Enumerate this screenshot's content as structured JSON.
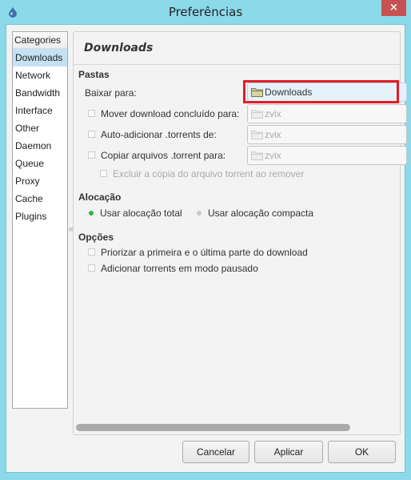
{
  "window": {
    "title": "Preferências",
    "close_label": "×"
  },
  "sidebar": {
    "header": "Categories",
    "items": [
      {
        "label": "Downloads",
        "selected": true
      },
      {
        "label": "Network"
      },
      {
        "label": "Bandwidth"
      },
      {
        "label": "Interface"
      },
      {
        "label": "Other"
      },
      {
        "label": "Daemon"
      },
      {
        "label": "Queue"
      },
      {
        "label": "Proxy"
      },
      {
        "label": "Cache"
      },
      {
        "label": "Plugins"
      }
    ]
  },
  "panel": {
    "title": "Downloads",
    "folders": {
      "heading": "Pastas",
      "download_to_label": "Baixar para:",
      "download_to_value": "Downloads",
      "move_completed_label": "Mover download concluído para:",
      "move_completed_value": "zvix",
      "auto_add_label": "Auto-adicionar .torrents de:",
      "auto_add_value": "zvix",
      "copy_torrent_label": "Copiar arquivos .torrent para:",
      "copy_torrent_value": "zvix",
      "delete_copy_label": "Excluir a cópia do arquivo torrent ao remover"
    },
    "allocation": {
      "heading": "Alocação",
      "full_label": "Usar alocação total",
      "compact_label": "Usar alocação compacta",
      "selected": "full"
    },
    "options": {
      "heading": "Opções",
      "prioritize_label": "Priorizar a primeira e o última parte do download",
      "add_paused_label": "Adicionar torrents em modo pausado"
    }
  },
  "buttons": {
    "cancel": "Cancelar",
    "apply": "Aplicar",
    "ok": "OK"
  },
  "colors": {
    "titlebar": "#8cd9ea",
    "close": "#c75050",
    "selected_item": "#c5e2f5",
    "highlight": "#e41b23",
    "radio_on": "#2eb35a"
  }
}
